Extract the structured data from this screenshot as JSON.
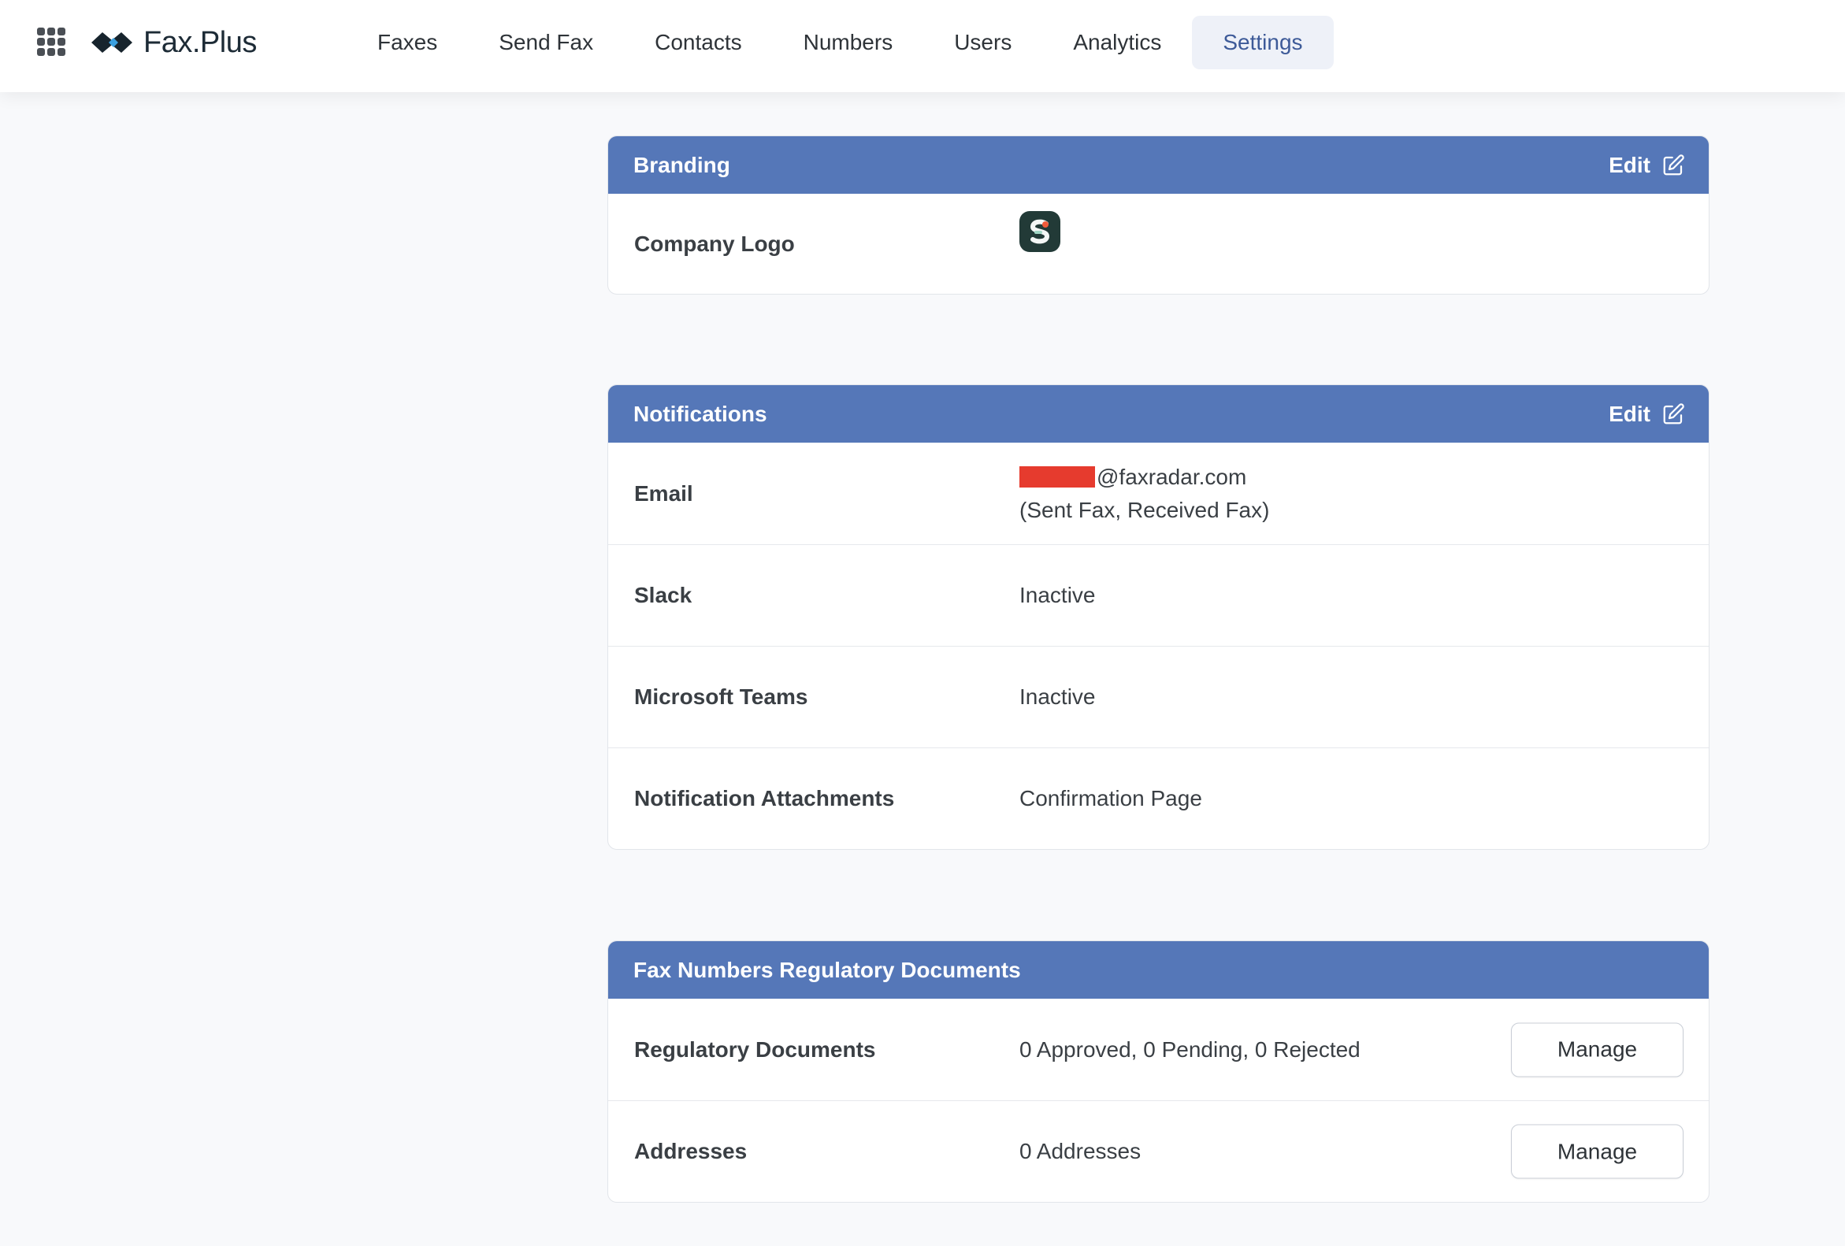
{
  "app": {
    "brand": "Fax.Plus",
    "colors": {
      "header": "#5577b8",
      "active_nav_bg": "#eef1f8",
      "active_nav_text": "#3d5a98",
      "redaction": "#e63b2e"
    }
  },
  "nav": {
    "items": [
      {
        "label": "Faxes"
      },
      {
        "label": "Send Fax"
      },
      {
        "label": "Contacts"
      },
      {
        "label": "Numbers"
      },
      {
        "label": "Users"
      },
      {
        "label": "Analytics"
      },
      {
        "label": "Settings",
        "active": true
      }
    ]
  },
  "branding": {
    "title": "Branding",
    "edit_label": "Edit",
    "rows": [
      {
        "label": "Company Logo"
      }
    ]
  },
  "notifications": {
    "title": "Notifications",
    "edit_label": "Edit",
    "email": {
      "label": "Email",
      "value_line1": "@faxradar.com",
      "value_line2": "(Sent Fax, Received Fax)"
    },
    "slack": {
      "label": "Slack",
      "value": "Inactive"
    },
    "teams": {
      "label": "Microsoft Teams",
      "value": "Inactive"
    },
    "attachments": {
      "label": "Notification Attachments",
      "value": "Confirmation Page"
    }
  },
  "regulatory": {
    "title": "Fax Numbers Regulatory Documents",
    "documents": {
      "label": "Regulatory Documents",
      "value": "0 Approved, 0 Pending, 0 Rejected",
      "button": "Manage"
    },
    "addresses": {
      "label": "Addresses",
      "value": "0 Addresses",
      "button": "Manage"
    }
  }
}
